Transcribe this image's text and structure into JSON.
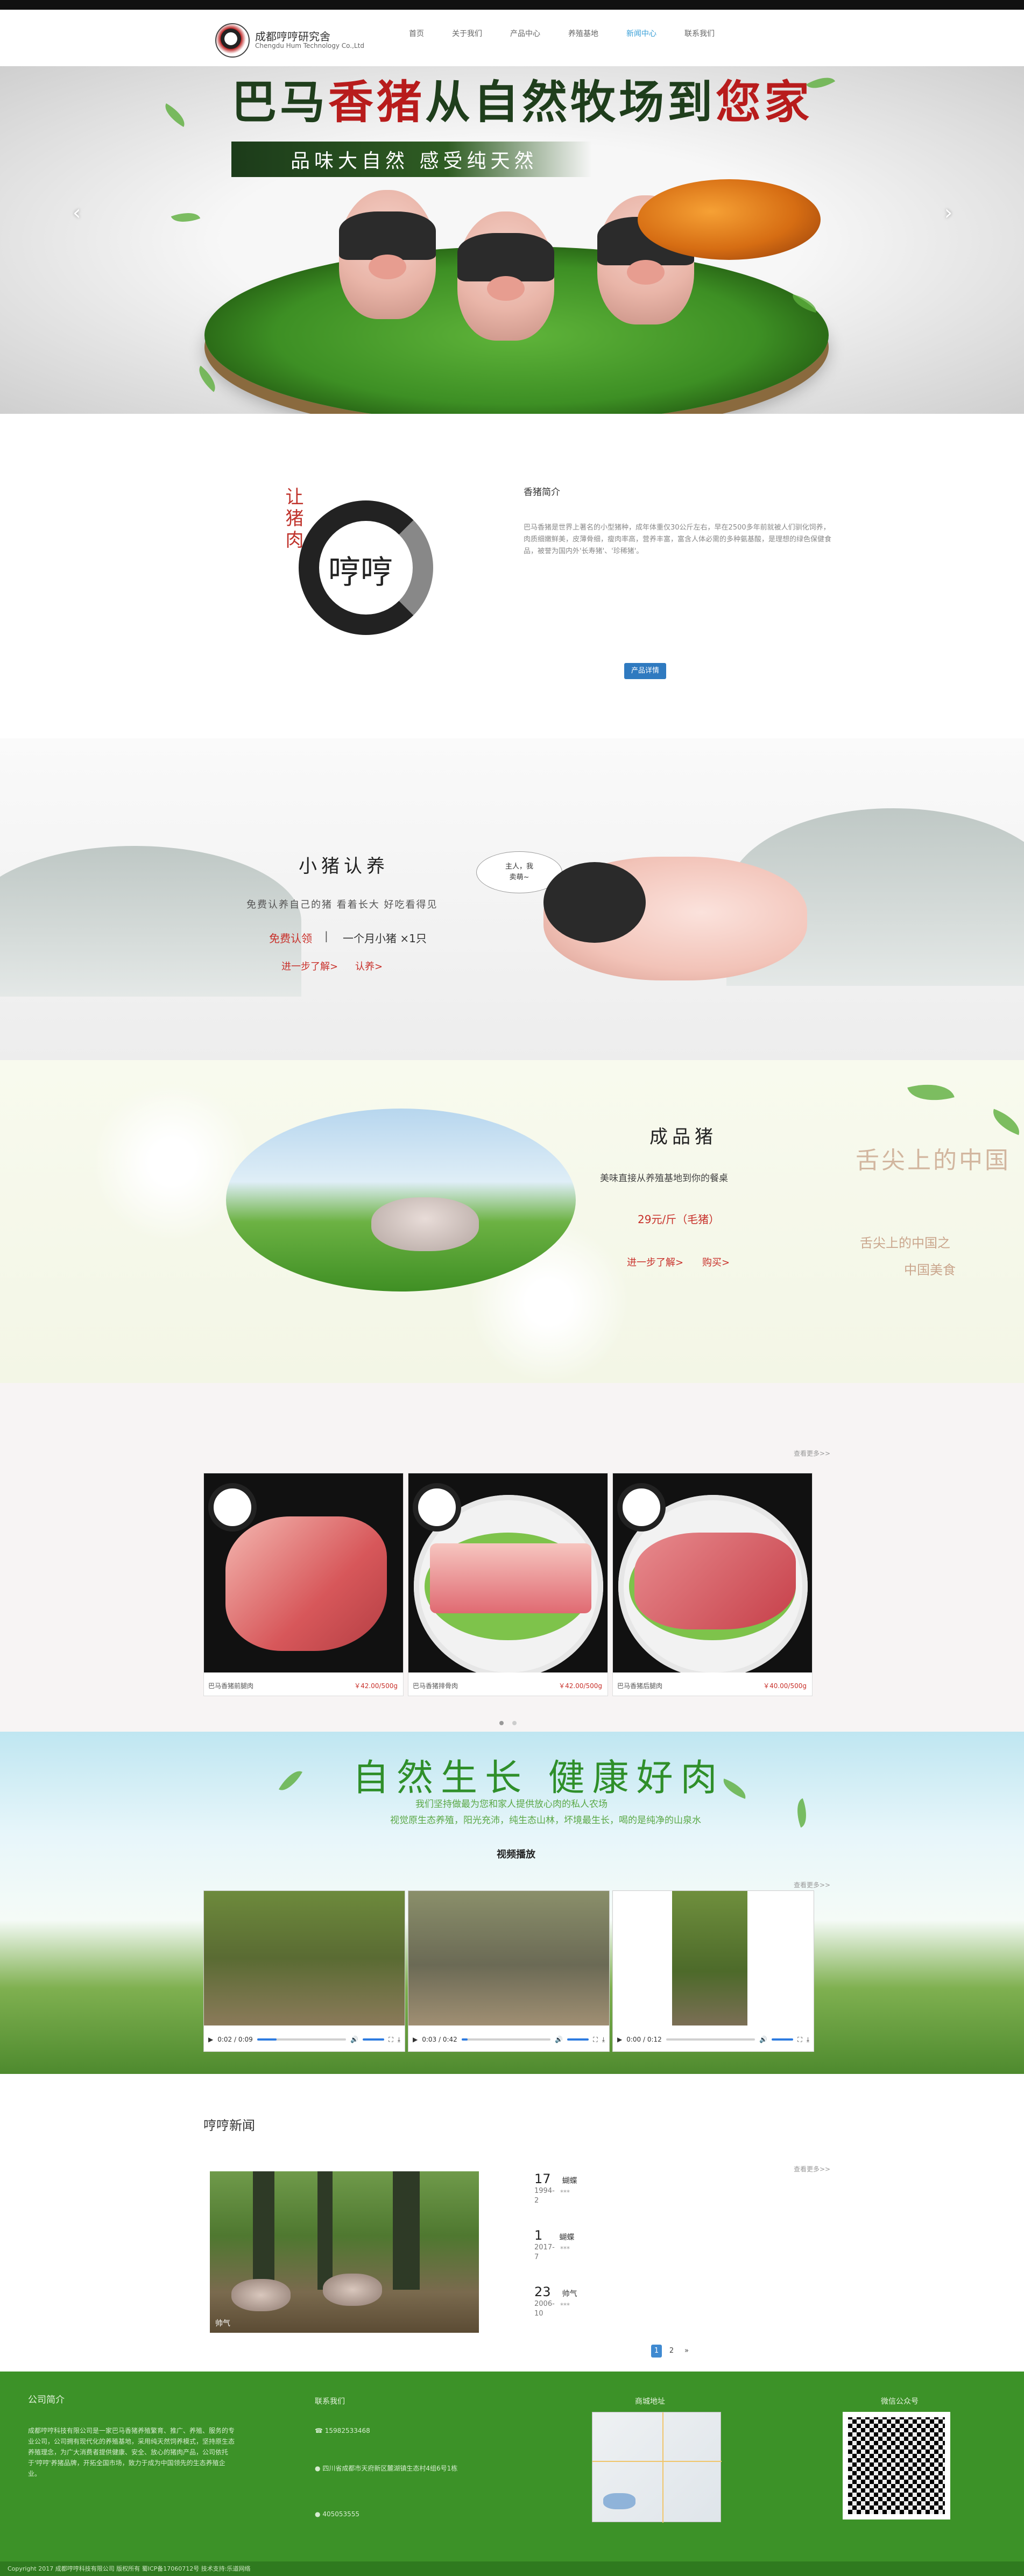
{
  "nav": {
    "logo_cn": "成都哼哼研究舍",
    "logo_en": "Chengdu Hum Technology Co.,Ltd",
    "items": [
      "首页",
      "关于我们",
      "产品中心",
      "养殖基地",
      "新闻中心",
      "联系我们"
    ],
    "active_index": 4
  },
  "hero": {
    "title_a": "巴马",
    "title_b": "香猪",
    "title_c": "从自然牧场到",
    "title_d": "您家",
    "ribbon": "品味大自然  感受纯天然",
    "prev": "‹",
    "next": "›"
  },
  "intro": {
    "vertical": "让猪肉",
    "seal": "哼哼",
    "title": "香猪简介",
    "body": "巴马香猪是世界上著名的小型猪种，成年体重仅30公斤左右，早在2500多年前就被人们驯化饲养，肉质细嫩鲜美，皮薄骨细，瘦肉率高，营养丰富，富含人体必需的多种氨基酸，是理想的绿色保健食品，被誉为国内外'长寿猪'、'珍稀猪'。",
    "button": "产品详情"
  },
  "adopt": {
    "heading": "小猪认养",
    "sub": "免费认养自己的猪  看着长大  好吃看得见",
    "free": "免费认领",
    "sep": "|",
    "one": "一个月小猪 ×1只",
    "link1": "进一步了解>",
    "link2": "认养>",
    "bubble": "主人，我\n卖萌~"
  },
  "finished": {
    "heading": "成品猪",
    "sub": "美味直接从养殖基地到你的餐桌",
    "price": "29元/斤（毛猪）",
    "link1": "进一步了解>",
    "link2": "购买>",
    "vtext": "舌尖上的中国",
    "t1": "舌尖上的中国之",
    "t2": "中国美食"
  },
  "products": {
    "more": "查看更多>>",
    "items": [
      {
        "name": "巴马香猪前腿肉",
        "price": "￥42.00/500g"
      },
      {
        "name": "巴马香猪排骨肉",
        "price": "￥42.00/500g"
      },
      {
        "name": "巴马香猪后腿肉",
        "price": "￥40.00/500g"
      }
    ]
  },
  "video": {
    "heading": "自然生长  健康好肉",
    "line1": "我们坚持做最为您和家人提供放心肉的私人农场",
    "line2": "视觉原生态养殖，阳光充沛，纯生态山林，坏境最生长，喝的是纯净的山泉水",
    "label": "视频播放",
    "more": "查看更多>>",
    "items": [
      {
        "time": "0:02 / 0:09",
        "progress": 0.22
      },
      {
        "time": "0:03 / 0:42",
        "progress": 0.07
      },
      {
        "time": "0:00 / 0:12",
        "progress": 0.0
      }
    ]
  },
  "news": {
    "heading": "哼哼新闻",
    "more": "查看更多>>",
    "image_caption": "帅气",
    "items": [
      {
        "day": "17",
        "ym": "1994-\n2",
        "title": "蝴蝶",
        "excerpt": "***"
      },
      {
        "day": "1",
        "ym": "2017-\n7",
        "title": "蝴蝶",
        "excerpt": "***"
      },
      {
        "day": "23",
        "ym": "2006-\n10",
        "title": "帅气",
        "excerpt": "***"
      }
    ],
    "pages": [
      "1",
      "2",
      "»"
    ],
    "page_active": 0
  },
  "footer": {
    "about_h": "公司简介",
    "about_body": "成都哼哼科技有限公司是一家巴马香猪养殖繁育、推广、养殖、服务的专业公司，公司拥有现代化的养殖基地，采用纯天然饲养模式，坚持原生态养殖理念，为广大消费者提供健康、安全、放心的猪肉产品，公司依托于'哼哼'养猪品牌，开拓全国市场，致力于成为中国领先的生态养殖企业。",
    "contact_h": "联系我们",
    "phone": "15982533468",
    "address": "四川省成都市天府新区麓湖镇生态村4组6号1栋",
    "qq": "405053555",
    "map_h": "商城地址",
    "qr_h": "微信公众号",
    "copyright": "Copyright 2017 成都哼哼科技有限公司 版权所有 蜀ICP备17060712号 技术支持:乐道网络"
  },
  "colors": {
    "accent": "#3c9228",
    "link": "#c8302a",
    "button": "#2f7ac0"
  }
}
